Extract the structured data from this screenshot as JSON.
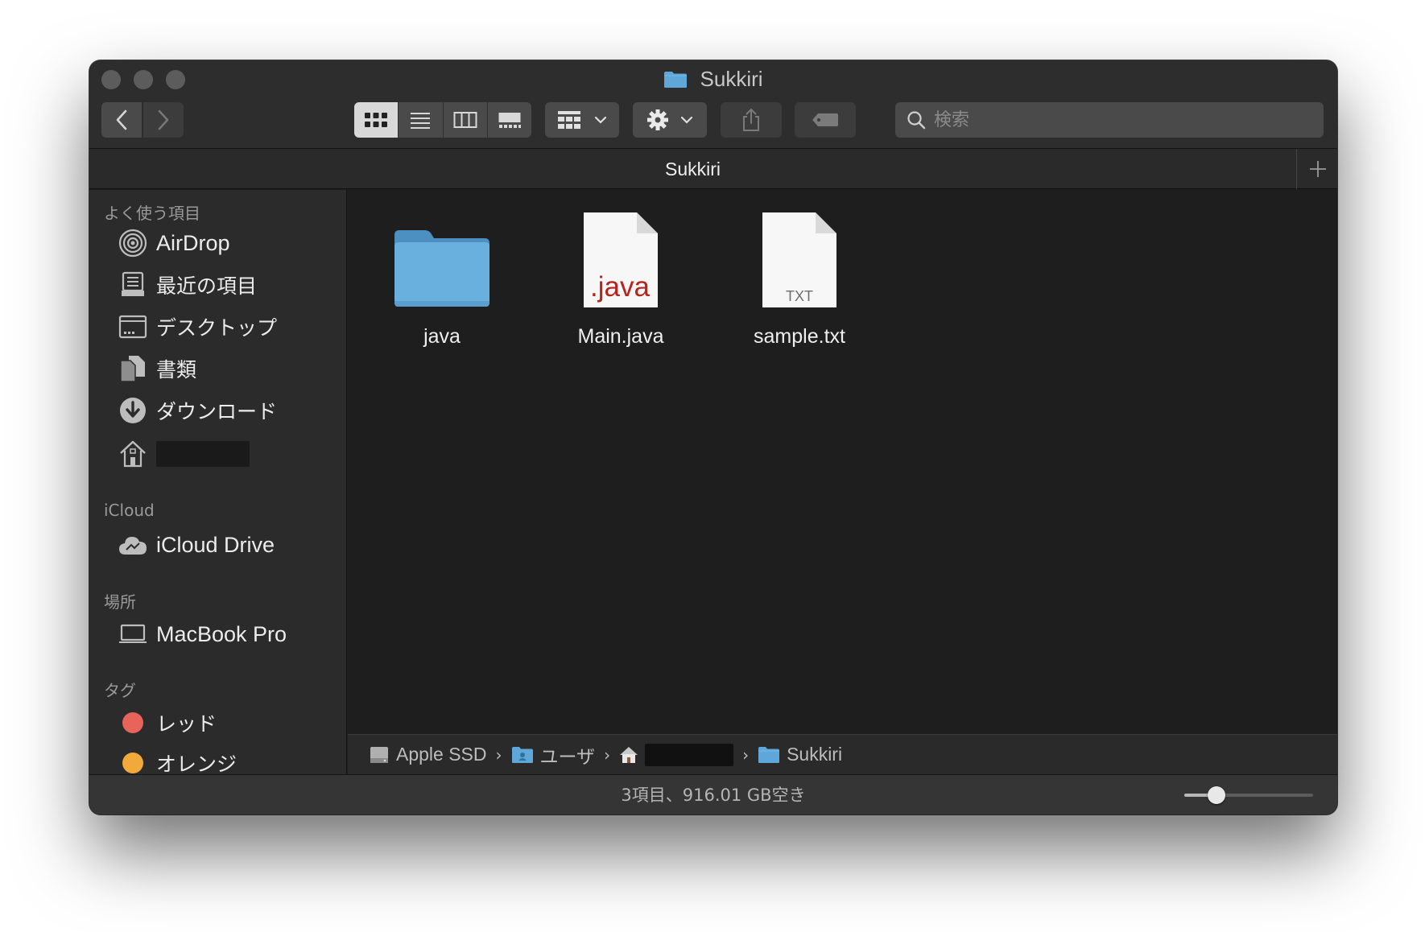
{
  "window": {
    "title": "Sukkiri",
    "title_icon": "folder-icon"
  },
  "toolbar": {
    "back_icon": "chevron-left-icon",
    "forward_icon": "chevron-right-icon",
    "views": [
      {
        "name": "icon-view",
        "icon": "grid-icon",
        "active": true
      },
      {
        "name": "list-view",
        "icon": "list-icon",
        "active": false
      },
      {
        "name": "column-view",
        "icon": "columns-icon",
        "active": false
      },
      {
        "name": "gallery-view",
        "icon": "gallery-icon",
        "active": false
      }
    ],
    "group_icon": "group-grid-icon",
    "action_icon": "gear-icon",
    "share_icon": "share-icon",
    "tag_icon": "tag-icon",
    "search_placeholder": "検索"
  },
  "tabbar": {
    "tab_label": "Sukkiri",
    "add_icon": "plus-icon"
  },
  "sidebar": {
    "sections": [
      {
        "header": "よく使う項目"
      },
      {
        "header": "iCloud"
      },
      {
        "header": "場所"
      },
      {
        "header": "タグ"
      }
    ],
    "favorites": [
      {
        "label": "AirDrop",
        "icon": "airdrop-icon"
      },
      {
        "label": "最近の項目",
        "icon": "recents-icon"
      },
      {
        "label": "デスクトップ",
        "icon": "desktop-icon"
      },
      {
        "label": "書類",
        "icon": "documents-icon"
      },
      {
        "label": "ダウンロード",
        "icon": "downloads-icon"
      },
      {
        "label": "",
        "icon": "home-icon"
      }
    ],
    "icloud": [
      {
        "label": "iCloud Drive",
        "icon": "icloud-icon"
      }
    ],
    "locations": [
      {
        "label": "MacBook Pro",
        "icon": "laptop-icon"
      }
    ],
    "tags": [
      {
        "label": "レッド",
        "color": "#e8635a"
      },
      {
        "label": "オレンジ",
        "color": "#f2a93b"
      }
    ]
  },
  "content": {
    "files": [
      {
        "name": "java",
        "type": "folder",
        "folder_color": "#5fa7d9"
      },
      {
        "name": "Main.java",
        "type": "java",
        "badge": ".java",
        "badge_color": "#b3261e"
      },
      {
        "name": "sample.txt",
        "type": "txt",
        "badge": "TXT"
      }
    ]
  },
  "pathbar": {
    "crumbs": [
      {
        "label": "Apple SSD",
        "icon": "disk-icon"
      },
      {
        "label": "ユーザ",
        "icon": "users-folder-icon"
      },
      {
        "label": "",
        "icon": "home-icon"
      },
      {
        "label": "Sukkiri",
        "icon": "folder-icon"
      }
    ]
  },
  "statusbar": {
    "text": "3項目、916.01 GB空き",
    "icon_size_fraction": 0.25
  },
  "colors": {
    "window_bg": "#1e1e1e",
    "sidebar_bg": "#2b2b2b",
    "toolbar_bg": "#2d2d2d",
    "folder_blue": "#5fa7d9"
  }
}
